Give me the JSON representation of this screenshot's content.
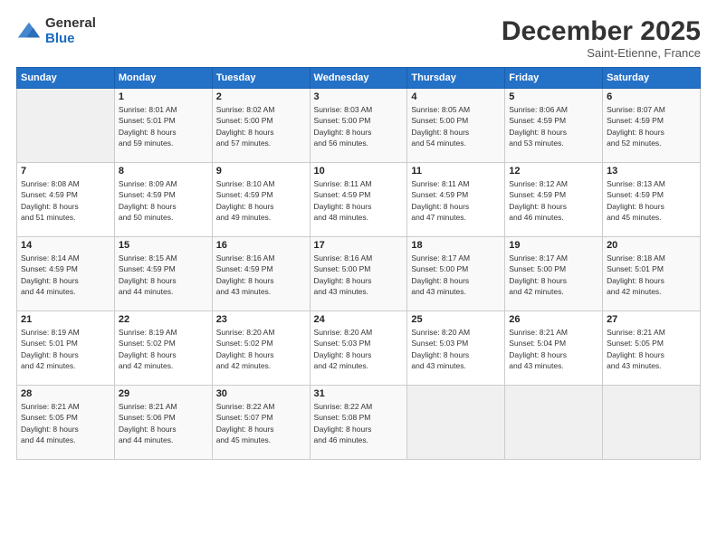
{
  "logo": {
    "general": "General",
    "blue": "Blue"
  },
  "header": {
    "month": "December 2025",
    "location": "Saint-Etienne, France"
  },
  "weekdays": [
    "Sunday",
    "Monday",
    "Tuesday",
    "Wednesday",
    "Thursday",
    "Friday",
    "Saturday"
  ],
  "weeks": [
    [
      {
        "day": "",
        "empty": true
      },
      {
        "day": "1",
        "sunrise": "8:01 AM",
        "sunset": "5:01 PM",
        "daylight": "8 hours and 59 minutes."
      },
      {
        "day": "2",
        "sunrise": "8:02 AM",
        "sunset": "5:00 PM",
        "daylight": "8 hours and 57 minutes."
      },
      {
        "day": "3",
        "sunrise": "8:03 AM",
        "sunset": "5:00 PM",
        "daylight": "8 hours and 56 minutes."
      },
      {
        "day": "4",
        "sunrise": "8:05 AM",
        "sunset": "5:00 PM",
        "daylight": "8 hours and 54 minutes."
      },
      {
        "day": "5",
        "sunrise": "8:06 AM",
        "sunset": "4:59 PM",
        "daylight": "8 hours and 53 minutes."
      },
      {
        "day": "6",
        "sunrise": "8:07 AM",
        "sunset": "4:59 PM",
        "daylight": "8 hours and 52 minutes."
      }
    ],
    [
      {
        "day": "7",
        "sunrise": "8:08 AM",
        "sunset": "4:59 PM",
        "daylight": "8 hours and 51 minutes."
      },
      {
        "day": "8",
        "sunrise": "8:09 AM",
        "sunset": "4:59 PM",
        "daylight": "8 hours and 50 minutes."
      },
      {
        "day": "9",
        "sunrise": "8:10 AM",
        "sunset": "4:59 PM",
        "daylight": "8 hours and 49 minutes."
      },
      {
        "day": "10",
        "sunrise": "8:11 AM",
        "sunset": "4:59 PM",
        "daylight": "8 hours and 48 minutes."
      },
      {
        "day": "11",
        "sunrise": "8:11 AM",
        "sunset": "4:59 PM",
        "daylight": "8 hours and 47 minutes."
      },
      {
        "day": "12",
        "sunrise": "8:12 AM",
        "sunset": "4:59 PM",
        "daylight": "8 hours and 46 minutes."
      },
      {
        "day": "13",
        "sunrise": "8:13 AM",
        "sunset": "4:59 PM",
        "daylight": "8 hours and 45 minutes."
      }
    ],
    [
      {
        "day": "14",
        "sunrise": "8:14 AM",
        "sunset": "4:59 PM",
        "daylight": "8 hours and 44 minutes."
      },
      {
        "day": "15",
        "sunrise": "8:15 AM",
        "sunset": "4:59 PM",
        "daylight": "8 hours and 44 minutes."
      },
      {
        "day": "16",
        "sunrise": "8:16 AM",
        "sunset": "4:59 PM",
        "daylight": "8 hours and 43 minutes."
      },
      {
        "day": "17",
        "sunrise": "8:16 AM",
        "sunset": "5:00 PM",
        "daylight": "8 hours and 43 minutes."
      },
      {
        "day": "18",
        "sunrise": "8:17 AM",
        "sunset": "5:00 PM",
        "daylight": "8 hours and 43 minutes."
      },
      {
        "day": "19",
        "sunrise": "8:17 AM",
        "sunset": "5:00 PM",
        "daylight": "8 hours and 42 minutes."
      },
      {
        "day": "20",
        "sunrise": "8:18 AM",
        "sunset": "5:01 PM",
        "daylight": "8 hours and 42 minutes."
      }
    ],
    [
      {
        "day": "21",
        "sunrise": "8:19 AM",
        "sunset": "5:01 PM",
        "daylight": "8 hours and 42 minutes."
      },
      {
        "day": "22",
        "sunrise": "8:19 AM",
        "sunset": "5:02 PM",
        "daylight": "8 hours and 42 minutes."
      },
      {
        "day": "23",
        "sunrise": "8:20 AM",
        "sunset": "5:02 PM",
        "daylight": "8 hours and 42 minutes."
      },
      {
        "day": "24",
        "sunrise": "8:20 AM",
        "sunset": "5:03 PM",
        "daylight": "8 hours and 42 minutes."
      },
      {
        "day": "25",
        "sunrise": "8:20 AM",
        "sunset": "5:03 PM",
        "daylight": "8 hours and 43 minutes."
      },
      {
        "day": "26",
        "sunrise": "8:21 AM",
        "sunset": "5:04 PM",
        "daylight": "8 hours and 43 minutes."
      },
      {
        "day": "27",
        "sunrise": "8:21 AM",
        "sunset": "5:05 PM",
        "daylight": "8 hours and 43 minutes."
      }
    ],
    [
      {
        "day": "28",
        "sunrise": "8:21 AM",
        "sunset": "5:05 PM",
        "daylight": "8 hours and 44 minutes."
      },
      {
        "day": "29",
        "sunrise": "8:21 AM",
        "sunset": "5:06 PM",
        "daylight": "8 hours and 44 minutes."
      },
      {
        "day": "30",
        "sunrise": "8:22 AM",
        "sunset": "5:07 PM",
        "daylight": "8 hours and 45 minutes."
      },
      {
        "day": "31",
        "sunrise": "8:22 AM",
        "sunset": "5:08 PM",
        "daylight": "8 hours and 46 minutes."
      },
      {
        "day": "",
        "empty": true
      },
      {
        "day": "",
        "empty": true
      },
      {
        "day": "",
        "empty": true
      }
    ]
  ]
}
